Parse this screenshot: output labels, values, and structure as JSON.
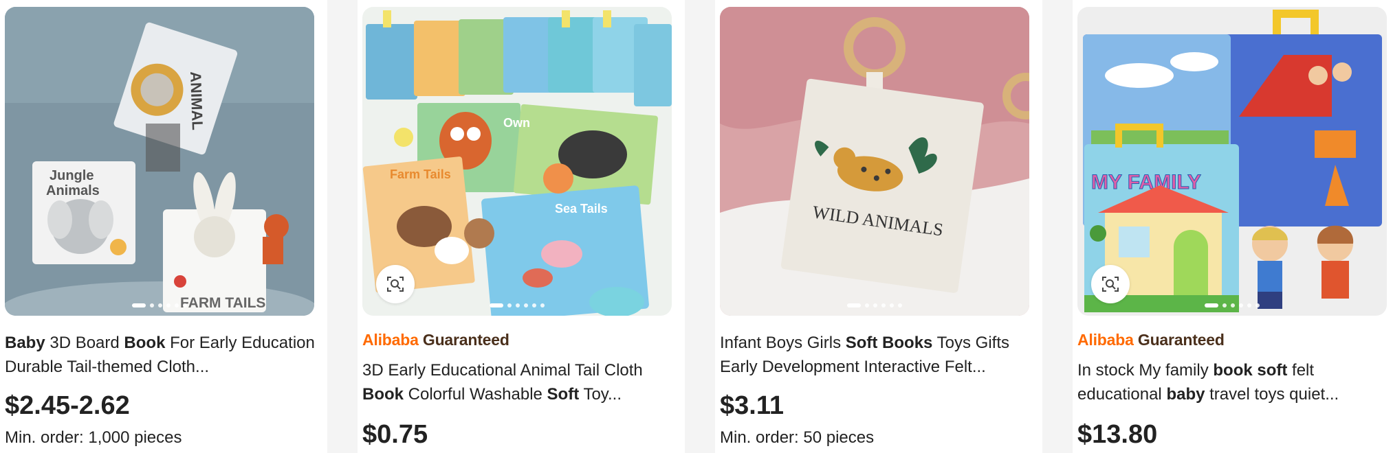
{
  "products": [
    {
      "guaranteed": false,
      "title_segments": [
        {
          "text": "Baby",
          "bold": true
        },
        {
          "text": " 3D Board ",
          "bold": false
        },
        {
          "text": "Book",
          "bold": true
        },
        {
          "text": " For Early Education Durable Tail-themed Cloth...",
          "bold": false
        }
      ],
      "price": "$2.45-2.62",
      "min_order": "Min. order: 1,000 pieces",
      "image_alt": "baby 3D cloth books: Animal, Jungle Animals, Farm Tails",
      "image_texts": {
        "a": "ANIMAL",
        "b": "Jungle",
        "c": "Animals",
        "d": "FARM TAILS"
      }
    },
    {
      "guaranteed": true,
      "guarantee_brand": "Alibaba",
      "guarantee_word": "Guaranteed",
      "title_segments": [
        {
          "text": "3D Early Educational Animal Tail Cloth ",
          "bold": false
        },
        {
          "text": "Book",
          "bold": true
        },
        {
          "text": " Colorful Washable ",
          "bold": false
        },
        {
          "text": "Soft",
          "bold": true
        },
        {
          "text": " Toy...",
          "bold": false
        }
      ],
      "price": "$0.75",
      "min_order": "",
      "image_alt": "colorful animal tail cloth books",
      "image_texts": {
        "a": "Farm Tails",
        "b": "Sea Tails",
        "c": "Own"
      }
    },
    {
      "guaranteed": false,
      "title_segments": [
        {
          "text": "Infant Boys Girls ",
          "bold": false
        },
        {
          "text": "Soft Books",
          "bold": true
        },
        {
          "text": " Toys Gifts Early Development Interactive Felt...",
          "bold": false
        }
      ],
      "price": "$3.11",
      "min_order": "Min. order: 50 pieces",
      "image_alt": "wild animals cloth book with wooden ring",
      "image_texts": {
        "a": "WILD ANIMALS"
      }
    },
    {
      "guaranteed": true,
      "guarantee_brand": "Alibaba",
      "guarantee_word": "Guaranteed",
      "title_segments": [
        {
          "text": "In stock My family ",
          "bold": false
        },
        {
          "text": "book soft",
          "bold": true
        },
        {
          "text": " felt educational ",
          "bold": false
        },
        {
          "text": "baby",
          "bold": true
        },
        {
          "text": " travel toys quiet...",
          "bold": false
        }
      ],
      "price": "$13.80",
      "min_order": "",
      "image_alt": "My family felt quiet book",
      "image_texts": {
        "a": "MY FAMILY"
      }
    }
  ],
  "colors": {
    "brand_orange": "#ff6a00",
    "guarantee_brown": "#4a2f1b",
    "text": "#222222",
    "page_bg": "#f4f4f4"
  },
  "icons": {
    "image_search": "image-search-icon",
    "carousel": "carousel-dots"
  }
}
